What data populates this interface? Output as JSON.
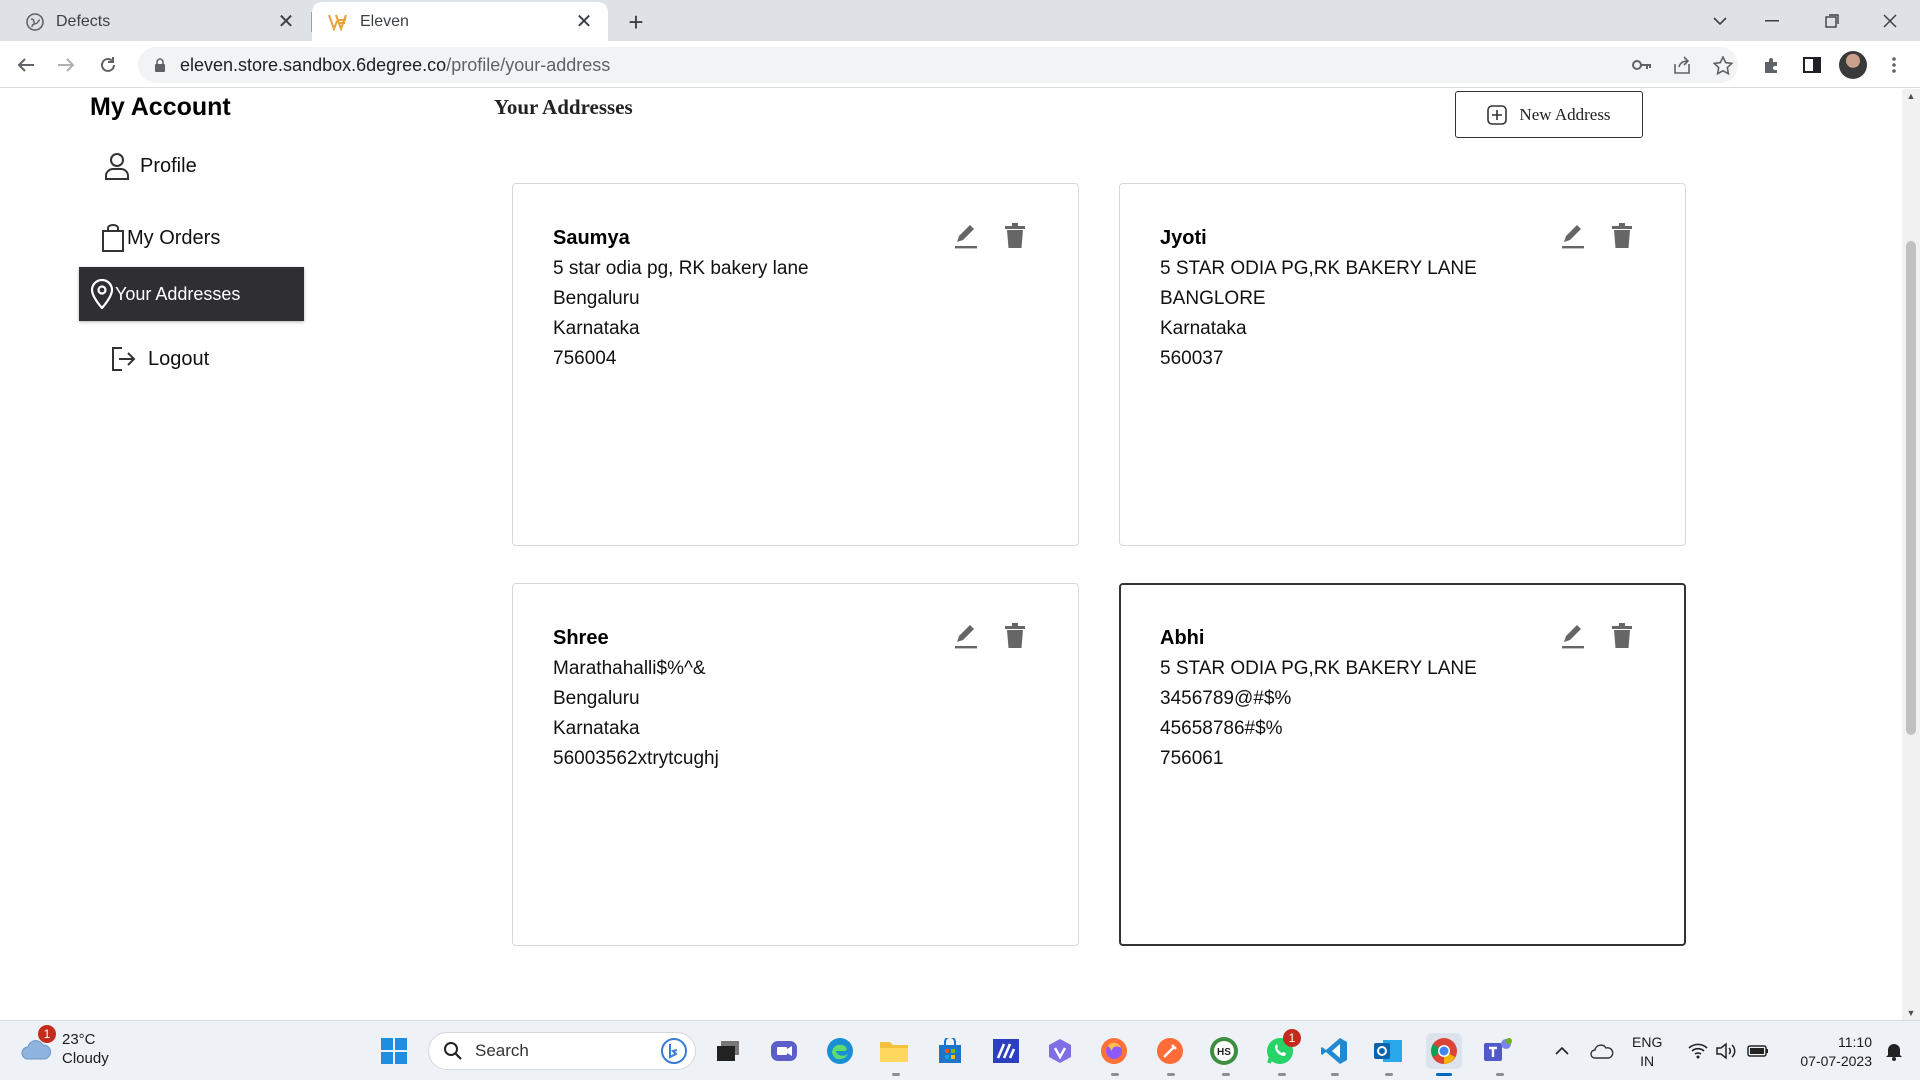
{
  "browser": {
    "tabs": [
      {
        "title": "Defects",
        "active": false
      },
      {
        "title": "Eleven",
        "active": true
      }
    ],
    "url_host": "eleven.store.sandbox.6degree.co",
    "url_path": "/profile/your-address"
  },
  "sidebar": {
    "title": "My Account",
    "items": [
      {
        "label": "Profile",
        "icon": "user-icon"
      },
      {
        "label": "My Orders",
        "icon": "shopping-bag-icon"
      },
      {
        "label": "Your Addresses",
        "icon": "location-pin-icon",
        "active": true
      },
      {
        "label": "Logout",
        "icon": "logout-icon"
      }
    ]
  },
  "main": {
    "title": "Your Addresses",
    "new_address_label": "New Address",
    "addresses": [
      {
        "name": "Saumya",
        "line1": "5 star odia pg, RK bakery lane",
        "city": "Bengaluru",
        "state": "Karnataka",
        "pin": "756004"
      },
      {
        "name": "Jyoti",
        "line1": "5 STAR ODIA PG,RK BAKERY LANE",
        "city": "BANGLORE",
        "state": "Karnataka",
        "pin": "560037"
      },
      {
        "name": "Shree",
        "line1": "Marathahalli$%^&",
        "city": "Bengaluru",
        "state": "Karnataka",
        "pin": "56003562xtrytcughj"
      },
      {
        "name": "Abhi",
        "line1": "5 STAR ODIA PG,RK BAKERY LANE",
        "city": "3456789@#$%",
        "state": "45658786#$%",
        "pin": "756061",
        "selected": true
      }
    ]
  },
  "taskbar": {
    "weather_temp": "23°C",
    "weather_desc": "Cloudy",
    "weather_badge": "1",
    "search_label": "Search",
    "whatsapp_badge": "1",
    "lang_1": "ENG",
    "lang_2": "IN",
    "time": "11:10",
    "date": "07-07-2023"
  },
  "colors": {
    "active_sidebar_bg": "#2f2f31",
    "accent_blue": "#0067c0"
  }
}
